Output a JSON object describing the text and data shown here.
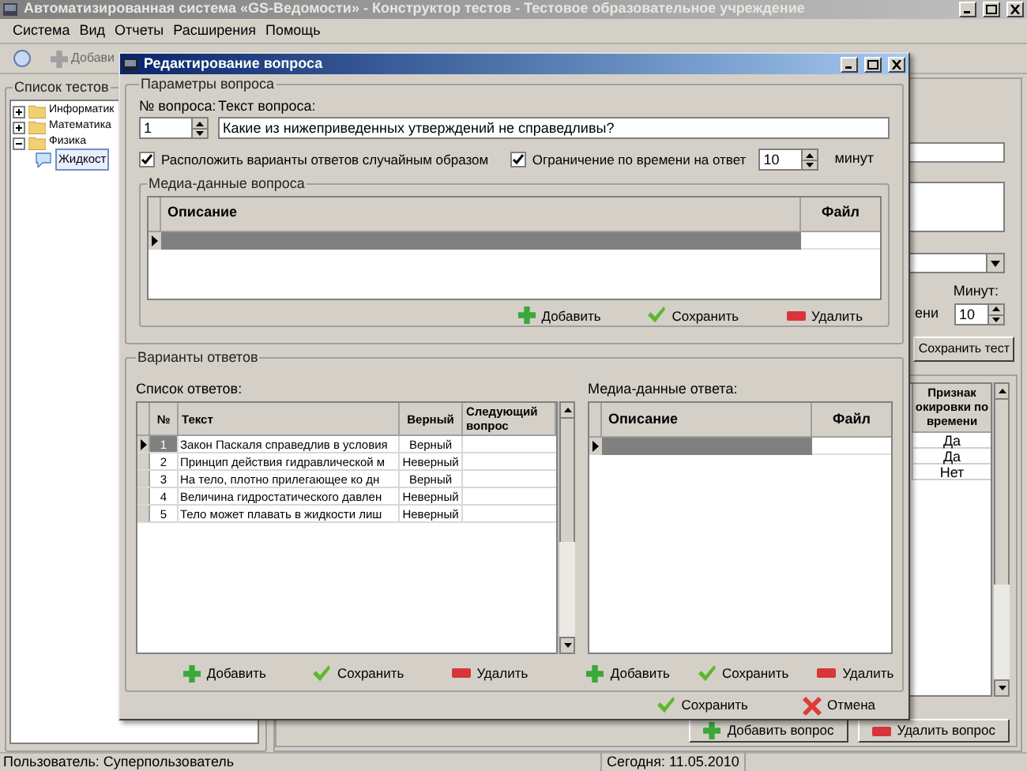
{
  "window": {
    "title": "Автоматизированная система «GS-Ведомости» - Конструктор тестов - Тестовое образовательное учреждение"
  },
  "menu": [
    "Система",
    "Вид",
    "Отчеты",
    "Расширения",
    "Помощь"
  ],
  "toolbar": {
    "add_label": "Добави"
  },
  "tests_panel": {
    "title": "Список тестов",
    "tree": [
      {
        "label": "Информатик",
        "expanded": false
      },
      {
        "label": "Математика",
        "expanded": false
      },
      {
        "label": "Физика",
        "expanded": true,
        "children": [
          {
            "label": "Жидкост",
            "selected": true
          }
        ]
      }
    ]
  },
  "test_form": {
    "minutes_label": "Минут:",
    "time_label": "ени",
    "minutes": "10",
    "save_button": "Сохранить тест"
  },
  "questions_table": {
    "header": [
      "Признак",
      "окировки по",
      "времени"
    ],
    "rows": [
      "Да",
      "Да",
      "Нет"
    ]
  },
  "question_buttons": [
    {
      "kind": "add",
      "label": "Добавить вопрос"
    },
    {
      "kind": "delete",
      "label": "Удалить вопрос"
    }
  ],
  "status_bar": [
    "Пользователь: Суперпользователь",
    "Сегодня: 11.05.2010"
  ],
  "dialog": {
    "title": "Редактирование вопроса",
    "params": {
      "title": "Параметры вопроса",
      "number_label": "№ вопроса:",
      "number": "1",
      "text_label": "Текст вопроса:",
      "text": "Какие из нижеприведенных утверждений не справедливы?",
      "shuffle": {
        "label": "Расположить варианты ответов случайным образом",
        "checked": true
      },
      "time_limit": {
        "label": "Ограничение по времени на ответ",
        "checked": true,
        "value": "10",
        "unit": "минут"
      }
    },
    "question_media": {
      "title": "Медиа-данные вопроса",
      "columns": [
        "Описание",
        "Файл"
      ],
      "buttons": [
        {
          "kind": "add",
          "label": "Добавить"
        },
        {
          "kind": "save",
          "label": "Сохранить"
        },
        {
          "kind": "delete",
          "label": "Удалить"
        }
      ]
    },
    "answers": {
      "title": "Варианты ответов",
      "list_label": "Список ответов:",
      "columns": [
        "№",
        "Текст",
        "Верный",
        "Следующий вопрос"
      ],
      "rows": [
        {
          "no": "1",
          "text": "Закон Паскаля справедлив в условия",
          "correct": "Верный",
          "selected": true
        },
        {
          "no": "2",
          "text": "Принцип действия гидравлической м",
          "correct": "Неверный",
          "selected": false
        },
        {
          "no": "3",
          "text": "На тело, плотно прилегающее ко дн",
          "correct": "Верный",
          "selected": false
        },
        {
          "no": "4",
          "text": "Величина гидростатического давлен",
          "correct": "Неверный",
          "selected": false
        },
        {
          "no": "5",
          "text": "Тело может плавать в жидкости лиш",
          "correct": "Неверный",
          "selected": false
        }
      ],
      "buttons": [
        {
          "kind": "add",
          "label": "Добавить"
        },
        {
          "kind": "save",
          "label": "Сохранить"
        },
        {
          "kind": "delete",
          "label": "Удалить"
        }
      ]
    },
    "answer_media": {
      "title": "Медиа-данные ответа:",
      "columns": [
        "Описание",
        "Файл"
      ],
      "buttons": [
        {
          "kind": "add",
          "label": "Добавить"
        },
        {
          "kind": "save",
          "label": "Сохранить"
        },
        {
          "kind": "delete",
          "label": "Удалить"
        }
      ]
    },
    "footer": [
      {
        "kind": "save",
        "label": "Сохранить"
      },
      {
        "kind": "cancel",
        "label": "Отмена"
      }
    ]
  }
}
